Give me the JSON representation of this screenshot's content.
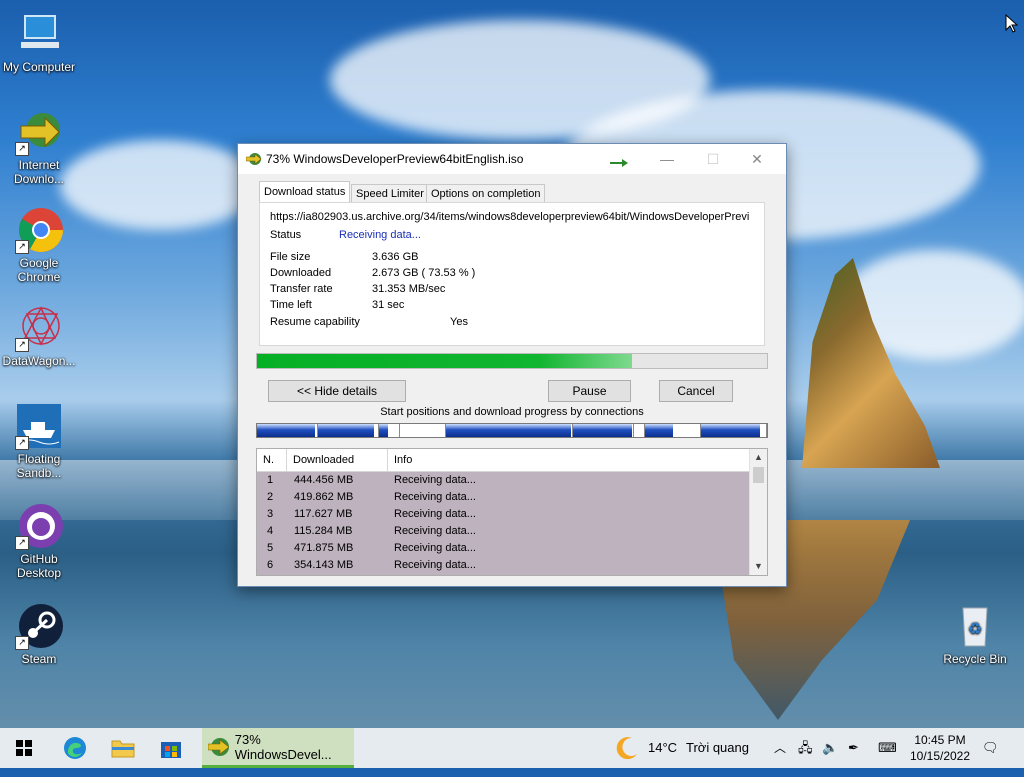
{
  "desktop": {
    "icons": [
      {
        "label": "My Computer",
        "icon": "computer-icon"
      },
      {
        "label": "Internet Downlo...",
        "icon": "idm-icon"
      },
      {
        "label": "Google Chrome",
        "icon": "chrome-icon"
      },
      {
        "label": "DataWagon...",
        "icon": "datawagon-icon"
      },
      {
        "label": "Floating Sandb...",
        "icon": "ship-icon"
      },
      {
        "label": "GitHub Desktop",
        "icon": "github-icon"
      },
      {
        "label": "Steam",
        "icon": "steam-icon"
      },
      {
        "label": "Recycle Bin",
        "icon": "recycle-bin-icon"
      }
    ]
  },
  "dialog": {
    "title": "73% WindowsDeveloperPreview64bitEnglish.iso",
    "tabs": [
      "Download status",
      "Speed Limiter",
      "Options on completion"
    ],
    "url": "https://ia802903.us.archive.org/34/items/windows8developerpreview64bit/WindowsDeveloperPrevi",
    "status_label": "Status",
    "status_value": "Receiving data...",
    "details": [
      {
        "label": "File size",
        "value": "3.636  GB"
      },
      {
        "label": "Downloaded",
        "value": "2.673  GB  ( 73.53 % )"
      },
      {
        "label": "Transfer rate",
        "value": "31.353  MB/sec"
      },
      {
        "label": "Time left",
        "value": "31 sec"
      },
      {
        "label": "Resume capability",
        "value": "Yes"
      }
    ],
    "progress_fraction": 0.7353,
    "buttons": {
      "hide_details": "<< Hide details",
      "pause": "Pause",
      "cancel": "Cancel"
    },
    "connections_caption": "Start positions and download progress by connections",
    "connection_segments": [
      {
        "start": 0.0,
        "end": 0.12,
        "done": 0.95
      },
      {
        "start": 0.12,
        "end": 0.24,
        "done": 0.92
      },
      {
        "start": 0.24,
        "end": 0.28,
        "done": 0.4
      },
      {
        "start": 0.28,
        "end": 0.37,
        "done": 0.0
      },
      {
        "start": 0.37,
        "end": 0.62,
        "done": 0.98
      },
      {
        "start": 0.62,
        "end": 0.74,
        "done": 0.96
      },
      {
        "start": 0.74,
        "end": 0.76,
        "done": 0.0
      },
      {
        "start": 0.76,
        "end": 0.87,
        "done": 0.5
      },
      {
        "start": 0.87,
        "end": 1.0,
        "done": 0.9
      }
    ],
    "table": {
      "headers": [
        "N.",
        "Downloaded",
        "Info"
      ],
      "rows": [
        [
          "1",
          "444.456  MB",
          "Receiving data..."
        ],
        [
          "2",
          "419.862  MB",
          "Receiving data..."
        ],
        [
          "3",
          "117.627  MB",
          "Receiving data..."
        ],
        [
          "4",
          "115.284  MB",
          "Receiving data..."
        ],
        [
          "5",
          "471.875  MB",
          "Receiving data..."
        ],
        [
          "6",
          "354.143  MB",
          "Receiving data..."
        ]
      ]
    }
  },
  "taskbar": {
    "active_app_label": "73% WindowsDevel...",
    "weather_temp": "14°C",
    "weather_text": "Trời quang",
    "time": "10:45 PM",
    "date": "10/15/2022"
  },
  "colors": {
    "progress_green": "#06b025",
    "status_blue": "#1a2fb5",
    "connection_blue": "#1f4fbf"
  }
}
